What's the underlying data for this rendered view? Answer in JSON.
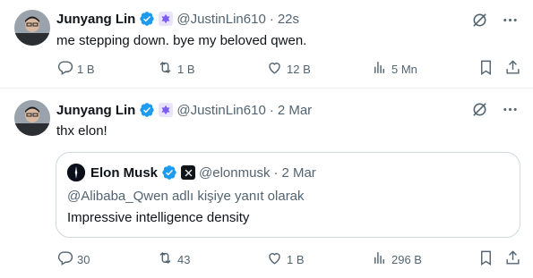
{
  "colors": {
    "text_primary": "#0f1419",
    "text_secondary": "#536471",
    "verified_blue": "#1d9bf0",
    "divider": "#eff3f4",
    "quote_border": "#cfd9de"
  },
  "tweets": [
    {
      "author_name": "Junyang Lin",
      "handle": "@JustinLin610",
      "separator": "·",
      "time": "22s",
      "text": "me stepping down. bye my beloved qwen.",
      "icons": {
        "avatar": "avatar-photo",
        "verified": "verified-badge-icon",
        "affiliation": "qwen-affiliation-badge",
        "top_right": [
          "grok-icon",
          "more-icon"
        ]
      },
      "actions": {
        "replies": "1 B",
        "reposts": "1 B",
        "likes": "12 B",
        "views": "5 Mn"
      }
    },
    {
      "author_name": "Junyang Lin",
      "handle": "@JustinLin610",
      "separator": "·",
      "time": "2 Mar",
      "text": "thx elon!",
      "icons": {
        "avatar": "avatar-photo",
        "verified": "verified-badge-icon",
        "affiliation": "qwen-affiliation-badge",
        "top_right": [
          "grok-icon",
          "more-icon"
        ]
      },
      "quote": {
        "author_name": "Elon Musk",
        "handle": "@elonmusk",
        "separator": "·",
        "time": "2 Mar",
        "reply_context": "@Alibaba_Qwen adlı kişiye yanıt olarak",
        "text": "Impressive intelligence density",
        "icons": {
          "avatar": "avatar-photo",
          "verified": "verified-badge-icon",
          "affiliation": "x-affiliation-badge"
        }
      },
      "actions": {
        "replies": "30",
        "reposts": "43",
        "likes": "1 B",
        "views": "296 B"
      }
    }
  ]
}
